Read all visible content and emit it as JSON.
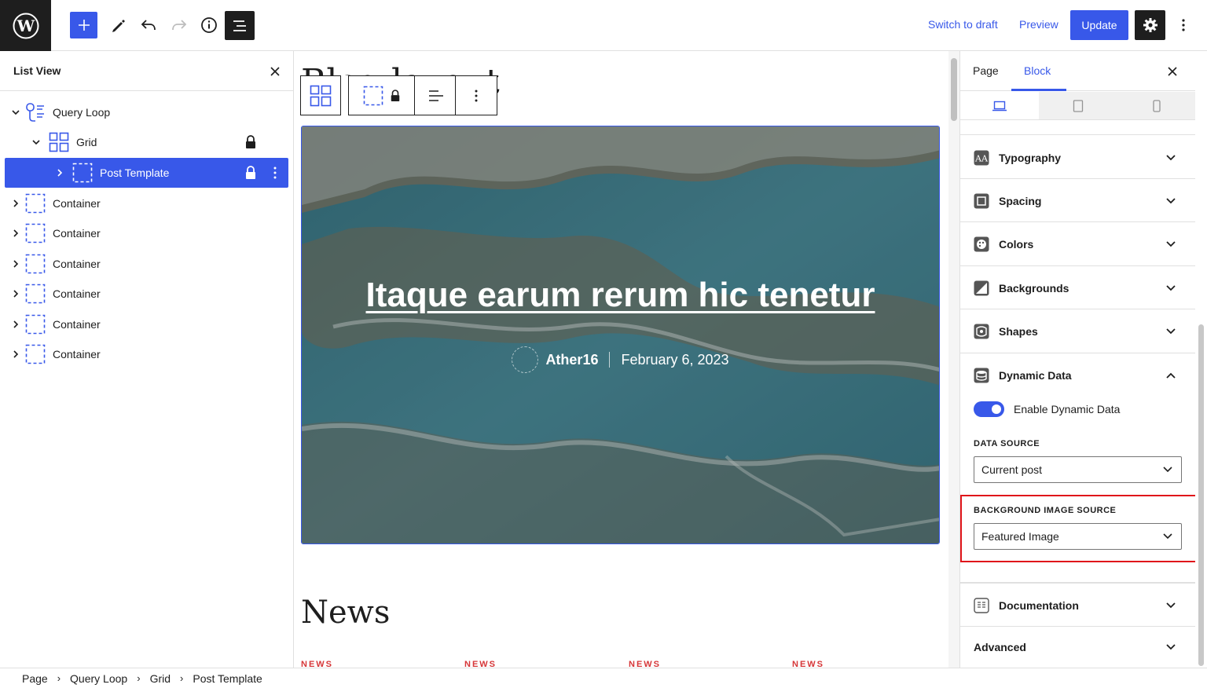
{
  "topbar": {
    "switch_to_draft": "Switch to draft",
    "preview": "Preview",
    "update": "Update"
  },
  "list_view": {
    "title": "List View",
    "items": [
      {
        "label": "Query Loop",
        "icon": "query-loop-icon",
        "level": 0
      },
      {
        "label": "Grid",
        "icon": "grid-icon",
        "level": 1,
        "locked": true
      },
      {
        "label": "Post Template",
        "icon": "container-icon",
        "level": 2,
        "locked": true,
        "selected": true
      },
      {
        "label": "Container",
        "icon": "container-icon",
        "level": 0
      },
      {
        "label": "Container",
        "icon": "container-icon",
        "level": 0
      },
      {
        "label": "Container",
        "icon": "container-icon",
        "level": 0
      },
      {
        "label": "Container",
        "icon": "container-icon",
        "level": 0
      },
      {
        "label": "Container",
        "icon": "container-icon",
        "level": 0
      },
      {
        "label": "Container",
        "icon": "container-icon",
        "level": 0
      }
    ]
  },
  "canvas": {
    "page_title_partial": "Blog layout",
    "hero": {
      "title": "Itaque earum rerum hic tenetur",
      "author": "Ather16",
      "date": "February 6, 2023"
    },
    "news_heading": "News",
    "news_tags": [
      "NEWS",
      "NEWS",
      "NEWS",
      "NEWS"
    ]
  },
  "sidebar": {
    "tabs": [
      "Page",
      "Block"
    ],
    "active_tab": "Block",
    "panels": [
      {
        "title": "Typography",
        "icon": "typography-icon",
        "open": false
      },
      {
        "title": "Spacing",
        "icon": "spacing-icon",
        "open": false
      },
      {
        "title": "Colors",
        "icon": "palette-icon",
        "open": false
      },
      {
        "title": "Backgrounds",
        "icon": "background-icon",
        "open": false
      },
      {
        "title": "Shapes",
        "icon": "shapes-icon",
        "open": false
      },
      {
        "title": "Dynamic Data",
        "icon": "database-icon",
        "open": true
      }
    ],
    "dynamic_data": {
      "toggle_label": "Enable Dynamic Data",
      "enabled": true,
      "data_source_label": "DATA SOURCE",
      "data_source_value": "Current post",
      "bg_source_label": "BACKGROUND IMAGE SOURCE",
      "bg_source_value": "Featured Image"
    },
    "documentation": "Documentation",
    "advanced": "Advanced"
  },
  "breadcrumb": [
    "Page",
    "Query Loop",
    "Grid",
    "Post Template"
  ],
  "colors": {
    "accent": "#3858e9",
    "dark": "#1e1e1e",
    "highlight": "#e0151a",
    "news_tag": "#d63638"
  }
}
